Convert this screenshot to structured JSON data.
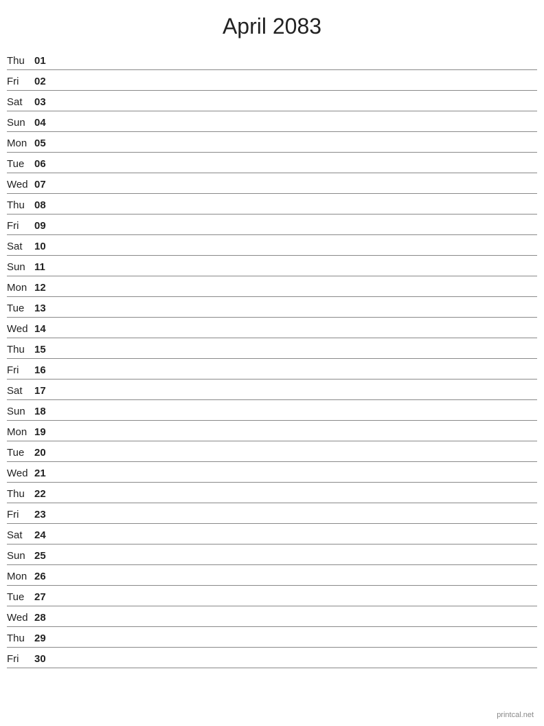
{
  "title": "April 2083",
  "footer": "printcal.net",
  "days": [
    {
      "name": "Thu",
      "number": "01"
    },
    {
      "name": "Fri",
      "number": "02"
    },
    {
      "name": "Sat",
      "number": "03"
    },
    {
      "name": "Sun",
      "number": "04"
    },
    {
      "name": "Mon",
      "number": "05"
    },
    {
      "name": "Tue",
      "number": "06"
    },
    {
      "name": "Wed",
      "number": "07"
    },
    {
      "name": "Thu",
      "number": "08"
    },
    {
      "name": "Fri",
      "number": "09"
    },
    {
      "name": "Sat",
      "number": "10"
    },
    {
      "name": "Sun",
      "number": "11"
    },
    {
      "name": "Mon",
      "number": "12"
    },
    {
      "name": "Tue",
      "number": "13"
    },
    {
      "name": "Wed",
      "number": "14"
    },
    {
      "name": "Thu",
      "number": "15"
    },
    {
      "name": "Fri",
      "number": "16"
    },
    {
      "name": "Sat",
      "number": "17"
    },
    {
      "name": "Sun",
      "number": "18"
    },
    {
      "name": "Mon",
      "number": "19"
    },
    {
      "name": "Tue",
      "number": "20"
    },
    {
      "name": "Wed",
      "number": "21"
    },
    {
      "name": "Thu",
      "number": "22"
    },
    {
      "name": "Fri",
      "number": "23"
    },
    {
      "name": "Sat",
      "number": "24"
    },
    {
      "name": "Sun",
      "number": "25"
    },
    {
      "name": "Mon",
      "number": "26"
    },
    {
      "name": "Tue",
      "number": "27"
    },
    {
      "name": "Wed",
      "number": "28"
    },
    {
      "name": "Thu",
      "number": "29"
    },
    {
      "name": "Fri",
      "number": "30"
    }
  ]
}
